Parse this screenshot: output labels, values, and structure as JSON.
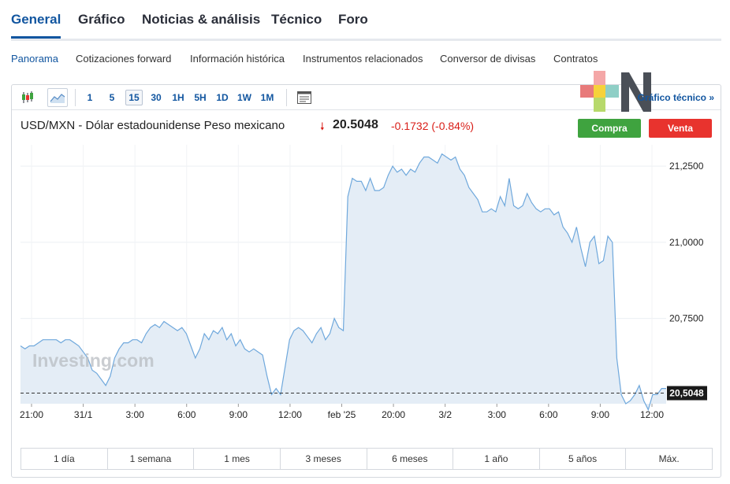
{
  "top_tabs": [
    "General",
    "Gráfico",
    "Noticias & análisis",
    "Técnico",
    "Foro"
  ],
  "sub_nav": [
    "Panorama",
    "Cotizaciones forward",
    "Información histórica",
    "Instrumentos relacionados",
    "Conversor de divisas",
    "Contratos"
  ],
  "toolbar": {
    "timeframes": [
      "1",
      "5",
      "15",
      "30",
      "1H",
      "5H",
      "1D",
      "1W",
      "1M"
    ],
    "active_timeframe": "15",
    "tech_link": "Gráfico técnico »"
  },
  "instrument": {
    "title": "USD/MXN - Dólar estadounidense Peso mexicano",
    "arrow": "🠗",
    "last": "20.5048",
    "change": "-0.1732",
    "change_pct": "(-0.84%)"
  },
  "buttons": {
    "buy": "Compra",
    "sell": "Venta"
  },
  "watermark": "Investing.com",
  "colors": {
    "accent": "#1256a0",
    "down": "#d91e18",
    "buy": "#3fa33f",
    "sell": "#e8332e",
    "line": "#6fa8dc",
    "fill": "#e4edf6"
  },
  "chart_data": {
    "type": "area",
    "y_ticks": [
      "21,2500",
      "21,0000",
      "20,7500"
    ],
    "ylim": [
      20.47,
      21.32
    ],
    "x_ticks": [
      "21:00",
      "31/1",
      "3:00",
      "6:00",
      "9:00",
      "12:00",
      "feb '25",
      "20:00",
      "3/2",
      "3:00",
      "6:00",
      "9:00",
      "12:00"
    ],
    "current_label": "20,5048",
    "current_value": 20.5048,
    "values": [
      20.66,
      20.65,
      20.66,
      20.66,
      20.67,
      20.68,
      20.68,
      20.68,
      20.68,
      20.67,
      20.68,
      20.68,
      20.67,
      20.66,
      20.64,
      20.62,
      20.58,
      20.57,
      20.55,
      20.53,
      20.56,
      20.62,
      20.65,
      20.67,
      20.67,
      20.68,
      20.68,
      20.67,
      20.7,
      20.72,
      20.73,
      20.72,
      20.74,
      20.73,
      20.72,
      20.71,
      20.72,
      20.7,
      20.66,
      20.62,
      20.65,
      20.7,
      20.68,
      20.71,
      20.7,
      20.72,
      20.68,
      20.7,
      20.66,
      20.68,
      20.65,
      20.64,
      20.65,
      20.64,
      20.63,
      20.56,
      20.5,
      20.52,
      20.5,
      20.59,
      20.68,
      20.71,
      20.72,
      20.71,
      20.69,
      20.67,
      20.7,
      20.72,
      20.68,
      20.7,
      20.75,
      20.72,
      20.71,
      21.15,
      21.21,
      21.2,
      21.2,
      21.17,
      21.21,
      21.17,
      21.17,
      21.18,
      21.22,
      21.25,
      21.23,
      21.24,
      21.22,
      21.24,
      21.23,
      21.26,
      21.28,
      21.28,
      21.27,
      21.26,
      21.29,
      21.28,
      21.27,
      21.28,
      21.24,
      21.22,
      21.18,
      21.16,
      21.14,
      21.1,
      21.1,
      21.11,
      21.1,
      21.15,
      21.12,
      21.21,
      21.12,
      21.11,
      21.12,
      21.16,
      21.13,
      21.11,
      21.1,
      21.11,
      21.11,
      21.09,
      21.1,
      21.05,
      21.03,
      21.0,
      21.05,
      20.98,
      20.92,
      21.0,
      21.02,
      20.93,
      20.94,
      21.02,
      21.0,
      20.62,
      20.5,
      20.47,
      20.48,
      20.5,
      20.53,
      20.48,
      20.45,
      20.5,
      20.5,
      20.52,
      20.52
    ]
  }
}
